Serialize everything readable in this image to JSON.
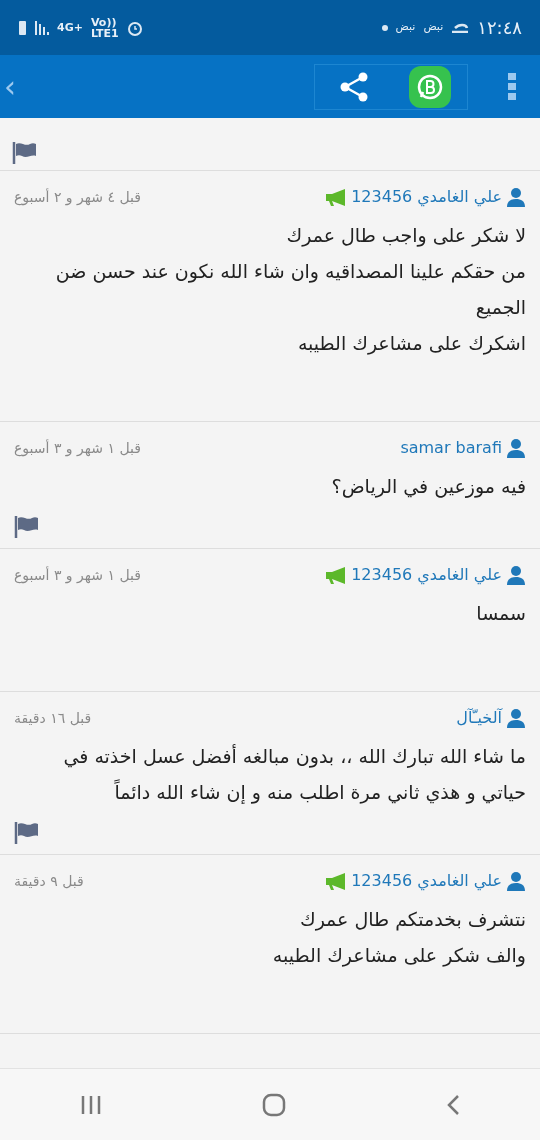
{
  "status_bar": {
    "time": "١٢:٤٨",
    "notifications": [
      "نبض",
      "نبض"
    ],
    "network": "4G+",
    "volte": "Vo))",
    "lte": "LTE1"
  },
  "top_bar": {
    "back": "‹"
  },
  "previous_comment": {
    "flag": true
  },
  "comments": [
    {
      "author": "علي الغامدي 123456",
      "advertiser": true,
      "time": "قبل ٤ شهر و ٢ أسبوع",
      "lines": [
        "لا شكر على واجب طال عمرك",
        "من حقكم علينا المصداقيه وان شاء الله نكون عند حسن ضن الجميع",
        "اشكرك على مشاعرك الطيبه"
      ],
      "flag": false
    },
    {
      "author": "samar barafi",
      "advertiser": false,
      "time": "قبل ١ شهر و ٣ أسبوع",
      "lines": [
        "فيه موزعين في الرياض؟"
      ],
      "flag": true
    },
    {
      "author": "علي الغامدي 123456",
      "advertiser": true,
      "time": "قبل ١ شهر و ٣ أسبوع",
      "lines": [
        "سمسا"
      ],
      "flag": false
    },
    {
      "author": "آلخيـّآل",
      "advertiser": false,
      "time": "قبل ١٦ دقيقة",
      "lines": [
        "ما شاء الله تبارك الله ،، بدون مبالغه أفضل عسل اخذته في حياتي و هذي ثاني مرة اطلب منه و إن شاء الله دائماً"
      ],
      "flag": true
    },
    {
      "author": "علي الغامدي 123456",
      "advertiser": true,
      "time": "قبل ٩ دقيقة",
      "lines": [
        "نتشرف بخدمتكم طال عمرك",
        "والف شكر على مشاعرك الطيبه"
      ],
      "flag": false
    }
  ]
}
